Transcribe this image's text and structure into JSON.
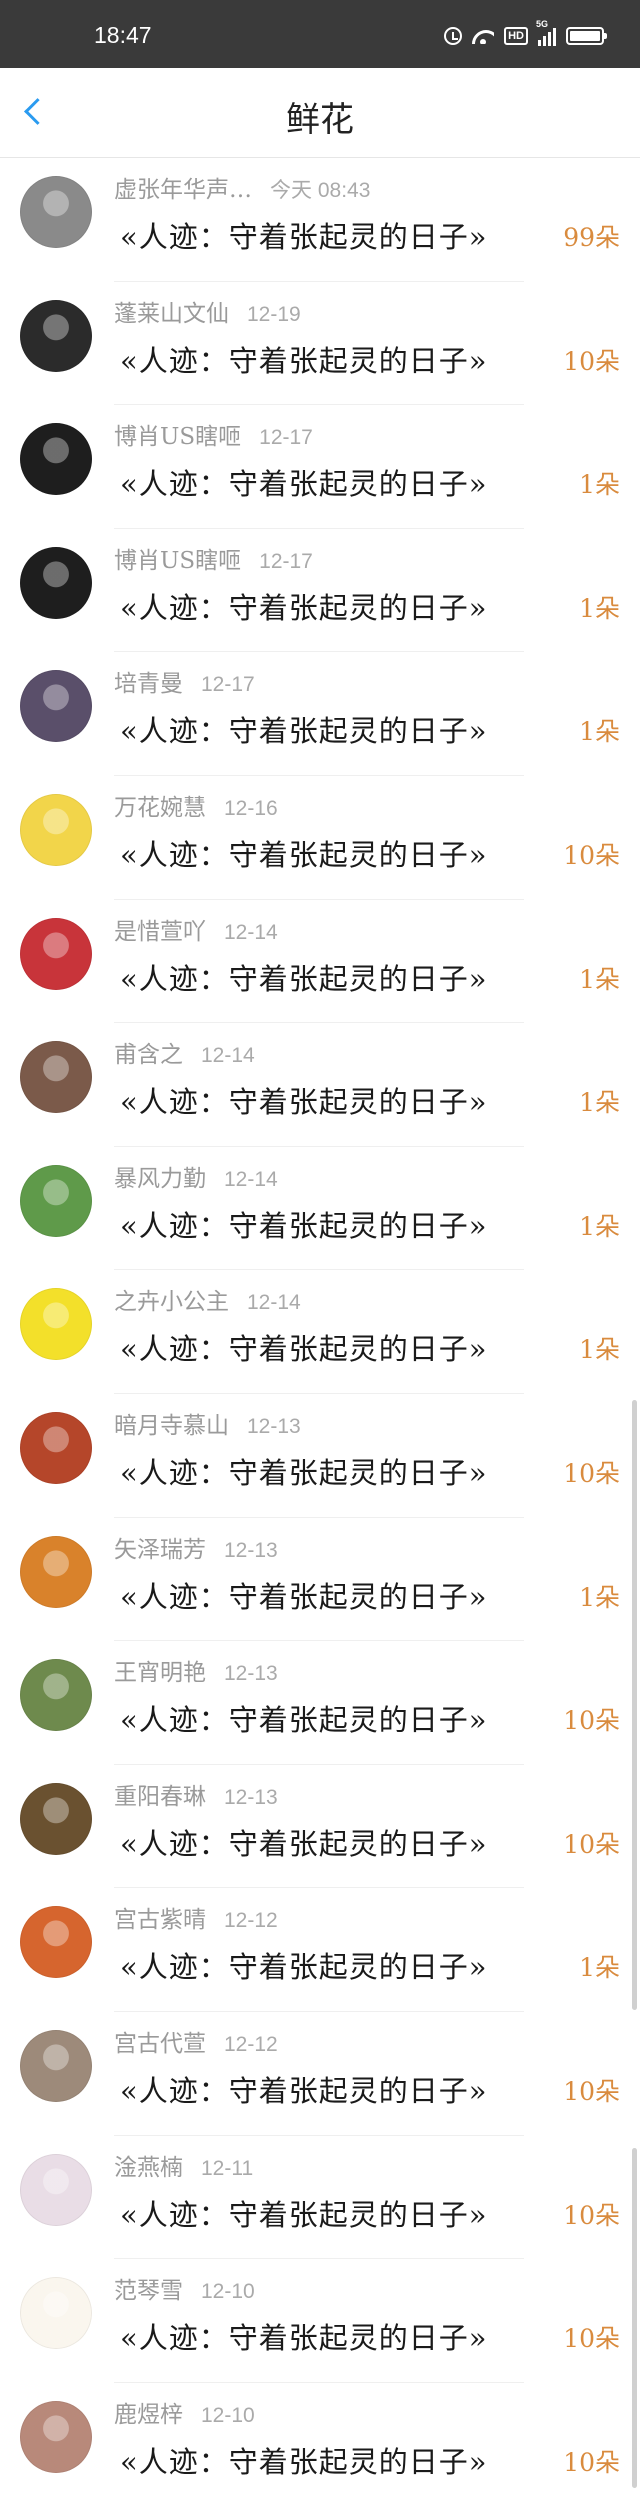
{
  "status": {
    "time": "18:47",
    "hd_label": "HD",
    "signal_label": "5G"
  },
  "header": {
    "title": "鲜花"
  },
  "items": [
    {
      "name": "虚张年华声…",
      "date": "今天 08:43",
      "message": "«人迹：守着张起灵的日子»",
      "count": "99朵",
      "avatar_color": "#8a8a8a"
    },
    {
      "name": "蓬莱山文仙",
      "date": "12-19",
      "message": "«人迹：守着张起灵的日子»",
      "count": "10朵",
      "avatar_color": "#2b2b2b"
    },
    {
      "name": "博肖US瞎咂",
      "date": "12-17",
      "message": "«人迹：守着张起灵的日子»",
      "count": "1朵",
      "avatar_color": "#1e1e1e"
    },
    {
      "name": "博肖US瞎咂",
      "date": "12-17",
      "message": "«人迹：守着张起灵的日子»",
      "count": "1朵",
      "avatar_color": "#1e1e1e"
    },
    {
      "name": "培青曼",
      "date": "12-17",
      "message": "«人迹：守着张起灵的日子»",
      "count": "1朵",
      "avatar_color": "#5a4f6a"
    },
    {
      "name": "万花婉慧",
      "date": "12-16",
      "message": "«人迹：守着张起灵的日子»",
      "count": "10朵",
      "avatar_color": "#f2d54a"
    },
    {
      "name": "是惜萱吖",
      "date": "12-14",
      "message": "«人迹：守着张起灵的日子»",
      "count": "1朵",
      "avatar_color": "#c8343a"
    },
    {
      "name": "甫含之",
      "date": "12-14",
      "message": "«人迹：守着张起灵的日子»",
      "count": "1朵",
      "avatar_color": "#7b5a4a"
    },
    {
      "name": "暴风力勤",
      "date": "12-14",
      "message": "«人迹：守着张起灵的日子»",
      "count": "1朵",
      "avatar_color": "#5f9a4a"
    },
    {
      "name": "之卉小公主",
      "date": "12-14",
      "message": "«人迹：守着张起灵的日子»",
      "count": "1朵",
      "avatar_color": "#f3e02a"
    },
    {
      "name": "暗月寺慕山",
      "date": "12-13",
      "message": "«人迹：守着张起灵的日子»",
      "count": "10朵",
      "avatar_color": "#b5462a"
    },
    {
      "name": "矢泽瑞芳",
      "date": "12-13",
      "message": "«人迹：守着张起灵的日子»",
      "count": "1朵",
      "avatar_color": "#d9822b"
    },
    {
      "name": "王宵明艳",
      "date": "12-13",
      "message": "«人迹：守着张起灵的日子»",
      "count": "10朵",
      "avatar_color": "#6e8a4d"
    },
    {
      "name": "重阳春琳",
      "date": "12-13",
      "message": "«人迹：守着张起灵的日子»",
      "count": "10朵",
      "avatar_color": "#6a5130"
    },
    {
      "name": "宫古紫晴",
      "date": "12-12",
      "message": "«人迹：守着张起灵的日子»",
      "count": "1朵",
      "avatar_color": "#d6652e"
    },
    {
      "name": "宫古代萱",
      "date": "12-12",
      "message": "«人迹：守着张起灵的日子»",
      "count": "10朵",
      "avatar_color": "#9d8a7a"
    },
    {
      "name": "淦燕楠",
      "date": "12-11",
      "message": "«人迹：守着张起灵的日子»",
      "count": "10朵",
      "avatar_color": "#e9dde6"
    },
    {
      "name": "范琴雪",
      "date": "12-10",
      "message": "«人迹：守着张起灵的日子»",
      "count": "10朵",
      "avatar_color": "#faf6ee"
    },
    {
      "name": "鹿煜梓",
      "date": "12-10",
      "message": "«人迹：守着张起灵的日子»",
      "count": "10朵",
      "avatar_color": "#b8897a"
    }
  ]
}
